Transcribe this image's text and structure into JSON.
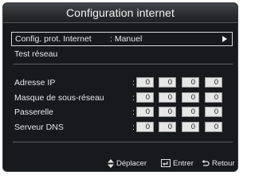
{
  "title": "Configuration internet",
  "protocol_row": {
    "label": "Config. prot. Internet",
    "value": ": Manuel"
  },
  "test_row": {
    "label": "Test réseau"
  },
  "ip_fields": [
    {
      "label": "Adresse IP",
      "colon": ":",
      "values": [
        "0",
        "0",
        "0",
        "0"
      ]
    },
    {
      "label": "Masque de sous-réseau",
      "colon": ":",
      "values": [
        "0",
        "0",
        "0",
        "0"
      ]
    },
    {
      "label": "Passerelle",
      "colon": ":",
      "values": [
        "0",
        "0",
        "0",
        "0"
      ]
    },
    {
      "label": "Serveur DNS",
      "colon": ":",
      "values": [
        "0",
        "0",
        "0",
        "0"
      ]
    }
  ],
  "footer": {
    "move_label": "Déplacer",
    "enter_label": "Entrer",
    "return_label": "Retour"
  },
  "icons": {
    "move": "updown-arrows-icon",
    "enter": "enter-icon",
    "return": "return-icon",
    "arrow": "right-arrow-icon"
  }
}
